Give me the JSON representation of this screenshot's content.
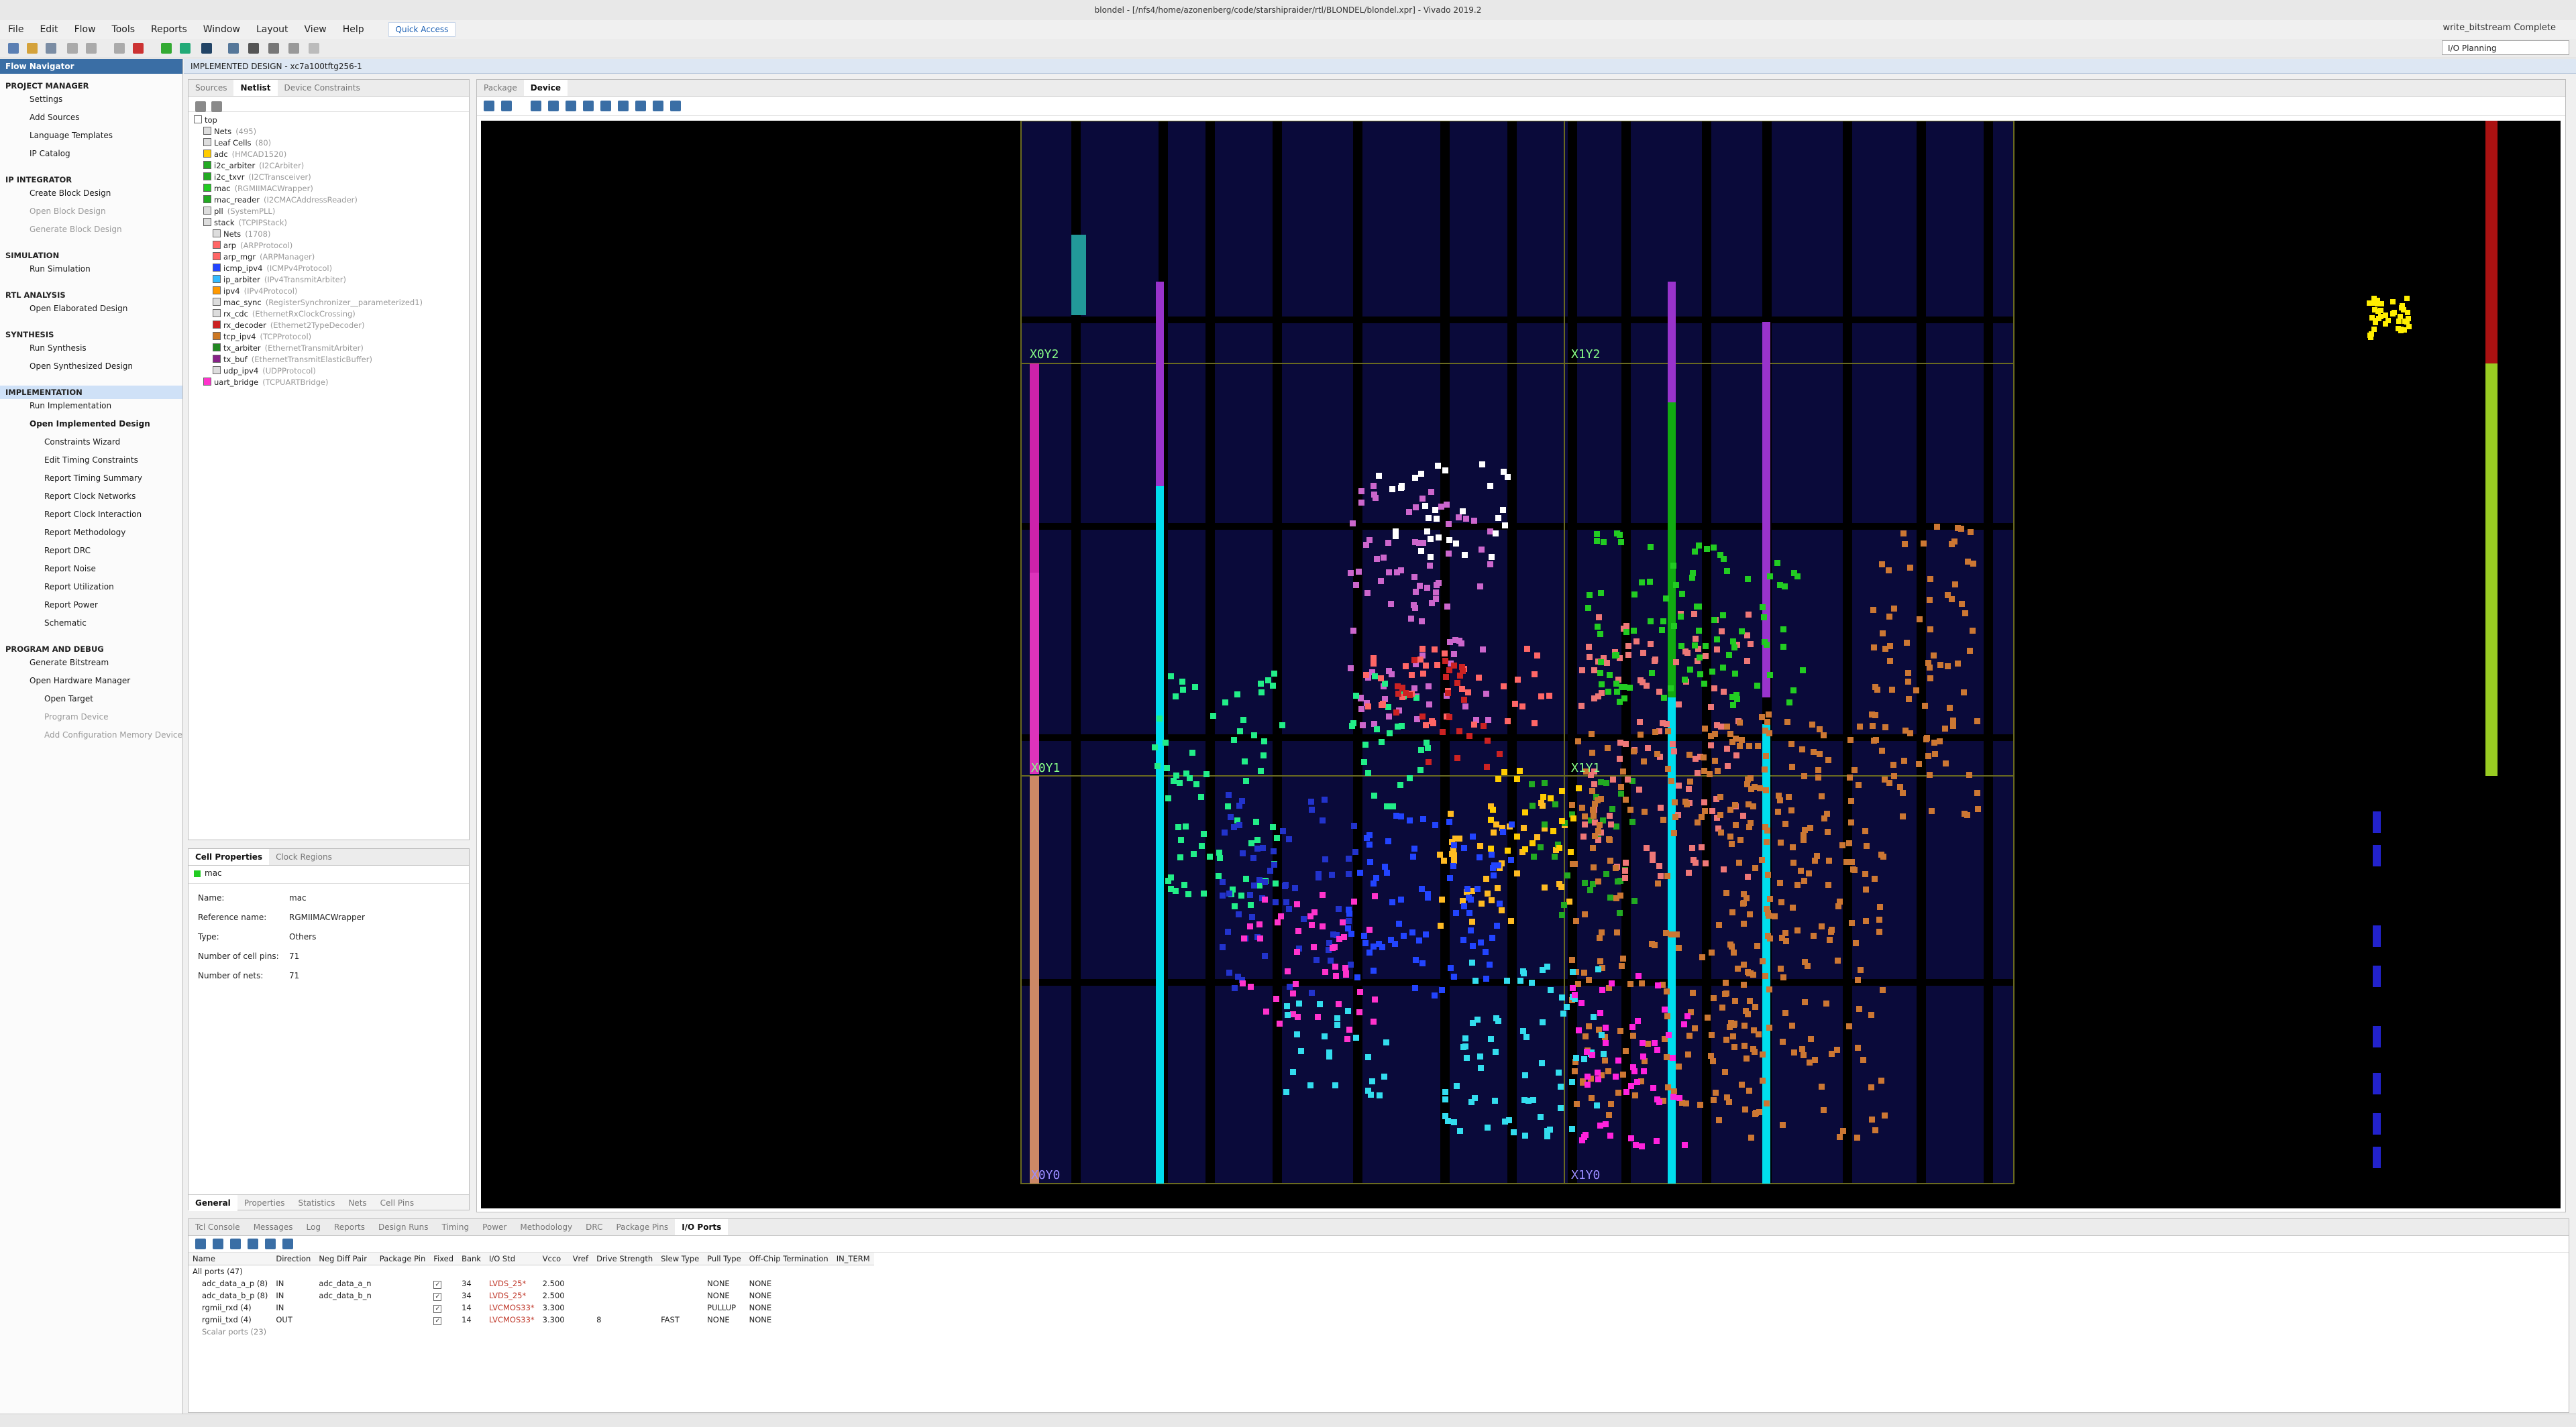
{
  "window": {
    "title": "blondel - [/nfs4/home/azonenberg/code/starshipraider/rtl/BLONDEL/blondel.xpr] - Vivado 2019.2"
  },
  "menu": {
    "items": [
      "File",
      "Edit",
      "Flow",
      "Tools",
      "Reports",
      "Window",
      "Layout",
      "View",
      "Help"
    ],
    "quick_access": "Quick Access"
  },
  "status": {
    "right": "write_bitstream Complete",
    "layout": "I/O Planning"
  },
  "flow_nav": {
    "title": "Flow Navigator",
    "sections": [
      {
        "label": "PROJECT MANAGER",
        "items": [
          "Settings",
          "Add Sources",
          "Language Templates",
          "IP Catalog"
        ]
      },
      {
        "label": "IP INTEGRATOR",
        "items": [
          "Create Block Design",
          "Open Block Design",
          "Generate Block Design"
        ]
      },
      {
        "label": "SIMULATION",
        "items": [
          "Run Simulation"
        ]
      },
      {
        "label": "RTL ANALYSIS",
        "items": [
          "Open Elaborated Design"
        ]
      },
      {
        "label": "SYNTHESIS",
        "items": [
          "Run Synthesis",
          "Open Synthesized Design"
        ]
      },
      {
        "label": "IMPLEMENTATION",
        "items": [
          "Run Implementation",
          "Open Implemented Design",
          "Constraints Wizard",
          "Edit Timing Constraints",
          "Report Timing Summary",
          "Report Clock Networks",
          "Report Clock Interaction",
          "Report Methodology",
          "Report DRC",
          "Report Noise",
          "Report Utilization",
          "Report Power",
          "Schematic"
        ]
      },
      {
        "label": "PROGRAM AND DEBUG",
        "items": [
          "Generate Bitstream",
          "Open Hardware Manager",
          "Open Target",
          "Program Device",
          "Add Configuration Memory Device"
        ]
      }
    ]
  },
  "design_header": "IMPLEMENTED DESIGN - xc7a100tftg256-1",
  "netlist": {
    "tabs": [
      "Sources",
      "Netlist",
      "Device Constraints"
    ],
    "rows": [
      {
        "name": "top",
        "type": ""
      },
      {
        "name": "Nets",
        "type": "(495)"
      },
      {
        "name": "Leaf Cells",
        "type": "(80)"
      },
      {
        "name": "adc",
        "type": "(HMCAD1520)"
      },
      {
        "name": "i2c_arbiter",
        "type": "(I2CArbiter)"
      },
      {
        "name": "i2c_txvr",
        "type": "(I2CTransceiver)"
      },
      {
        "name": "mac",
        "type": "(RGMIIMACWrapper)"
      },
      {
        "name": "mac_reader",
        "type": "(I2CMACAddressReader)"
      },
      {
        "name": "pll",
        "type": "(SystemPLL)"
      },
      {
        "name": "stack",
        "type": "(TCPIPStack)"
      },
      {
        "name": "Nets",
        "type": "(1708)"
      },
      {
        "name": "arp",
        "type": "(ARPProtocol)"
      },
      {
        "name": "arp_mgr",
        "type": "(ARPManager)"
      },
      {
        "name": "icmp_ipv4",
        "type": "(ICMPv4Protocol)"
      },
      {
        "name": "ip_arbiter",
        "type": "(IPv4TransmitArbiter)"
      },
      {
        "name": "ipv4",
        "type": "(IPv4Protocol)"
      },
      {
        "name": "mac_sync",
        "type": "(RegisterSynchronizer__parameterized1)"
      },
      {
        "name": "rx_cdc",
        "type": "(EthernetRxClockCrossing)"
      },
      {
        "name": "rx_decoder",
        "type": "(Ethernet2TypeDecoder)"
      },
      {
        "name": "tcp_ipv4",
        "type": "(TCPProtocol)"
      },
      {
        "name": "tx_arbiter",
        "type": "(EthernetTransmitArbiter)"
      },
      {
        "name": "tx_buf",
        "type": "(EthernetTransmitElasticBuffer)"
      },
      {
        "name": "udp_ipv4",
        "type": "(UDPProtocol)"
      },
      {
        "name": "uart_bridge",
        "type": "(TCPUARTBridge)"
      }
    ],
    "swatches": [
      "#ffffff",
      "#dddddd",
      "#dddddd",
      "#ffcc00",
      "#22aa22",
      "#22aa22",
      "#22cc22",
      "#22aa22",
      "#dddddd",
      "#dddddd",
      "#dddddd",
      "#ff6666",
      "#ff6666",
      "#2244ff",
      "#33bbff",
      "#ff9900",
      "#dddddd",
      "#dddddd",
      "#cc2222",
      "#cc7722",
      "#228822",
      "#882288",
      "#dddddd",
      "#ff33cc"
    ]
  },
  "cell_props": {
    "tabs": [
      "Cell Properties",
      "Clock Regions"
    ],
    "selected": "mac",
    "fields": [
      {
        "label": "Name:",
        "value": "mac"
      },
      {
        "label": "Reference name:",
        "value": "RGMIIMACWrapper"
      },
      {
        "label": "Type:",
        "value": "Others"
      },
      {
        "label": "Number of cell pins:",
        "value": "71"
      },
      {
        "label": "Number of nets:",
        "value": "71"
      }
    ],
    "bottom_tabs": [
      "General",
      "Properties",
      "Statistics",
      "Nets",
      "Cell Pins"
    ]
  },
  "device_view": {
    "tabs": [
      "Package",
      "Device"
    ],
    "regions": [
      "X0Y2",
      "X1Y2",
      "X0Y1",
      "X1Y1",
      "X0Y0",
      "X1Y0"
    ]
  },
  "bottom_panel": {
    "tabs": [
      "Tcl Console",
      "Messages",
      "Log",
      "Reports",
      "Design Runs",
      "Timing",
      "Power",
      "Methodology",
      "DRC",
      "Package Pins",
      "I/O Ports"
    ],
    "columns": [
      "Name",
      "Direction",
      "Neg Diff Pair",
      "Package Pin",
      "Fixed",
      "Bank",
      "I/O Std",
      "Vcco",
      "Vref",
      "Drive Strength",
      "Slew Type",
      "Pull Type",
      "Off-Chip Termination",
      "IN_TERM"
    ],
    "group": "All ports (47)",
    "rows": [
      {
        "name": "adc_data_a_p (8)",
        "dir": "IN",
        "neg": "adc_data_a_n",
        "pin": "",
        "bank": "34",
        "std": "LVDS_25*",
        "vcco": "2.500",
        "vref": "",
        "drive": "",
        "slew": "",
        "pull": "NONE",
        "term": "NONE"
      },
      {
        "name": "adc_data_b_p (8)",
        "dir": "IN",
        "neg": "adc_data_b_n",
        "pin": "",
        "bank": "34",
        "std": "LVDS_25*",
        "vcco": "2.500",
        "vref": "",
        "drive": "",
        "slew": "",
        "pull": "NONE",
        "term": "NONE"
      },
      {
        "name": "rgmii_rxd (4)",
        "dir": "IN",
        "neg": "",
        "pin": "",
        "bank": "14",
        "std": "LVCMOS33*",
        "vcco": "3.300",
        "vref": "",
        "drive": "",
        "slew": "",
        "pull": "PULLUP",
        "term": "NONE"
      },
      {
        "name": "rgmii_txd (4)",
        "dir": "OUT",
        "neg": "",
        "pin": "",
        "bank": "14",
        "std": "LVCMOS33*",
        "vcco": "3.300",
        "vref": "",
        "drive": "8",
        "slew": "FAST",
        "pull": "NONE",
        "term": "NONE"
      }
    ],
    "scalar": "Scalar ports (23)"
  }
}
